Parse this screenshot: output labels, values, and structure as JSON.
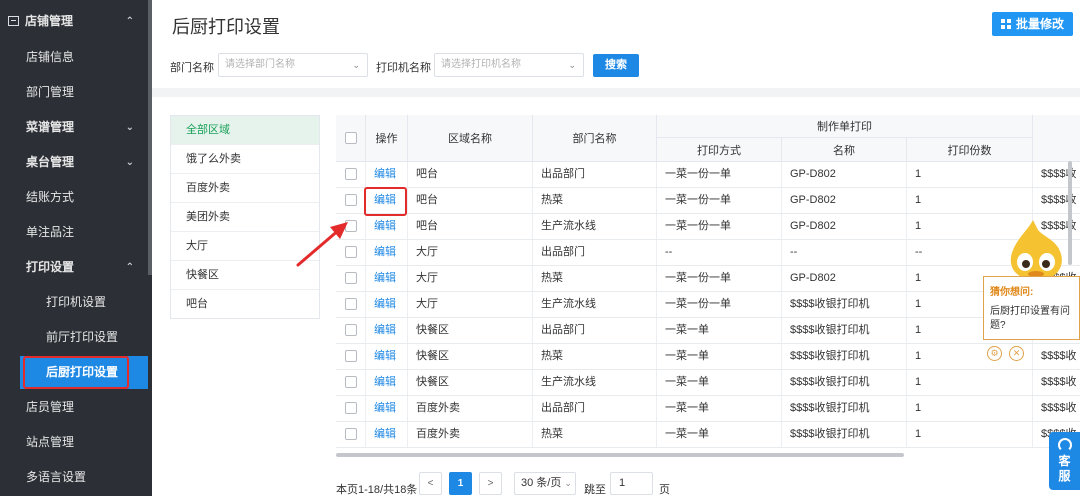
{
  "sidebar": {
    "items": [
      {
        "label": "店铺管理"
      },
      {
        "label": "店铺信息"
      },
      {
        "label": "部门管理"
      },
      {
        "label": "菜谱管理"
      },
      {
        "label": "桌台管理"
      },
      {
        "label": "结账方式"
      },
      {
        "label": "单注品注"
      },
      {
        "label": "打印设置"
      },
      {
        "label": "打印机设置"
      },
      {
        "label": "前厅打印设置"
      },
      {
        "label": "后厨打印设置"
      },
      {
        "label": "店员管理"
      },
      {
        "label": "站点管理"
      },
      {
        "label": "多语言设置"
      }
    ]
  },
  "header": {
    "title": "后厨打印设置",
    "batch_label": "批量修改"
  },
  "filters": {
    "dept_label": "部门名称",
    "dept_placeholder": "请选择部门名称",
    "printer_label": "打印机名称",
    "printer_placeholder": "请选择打印机名称",
    "search_label": "搜索"
  },
  "regions": [
    "全部区域",
    "饿了么外卖",
    "百度外卖",
    "美团外卖",
    "大厅",
    "快餐区",
    "吧台"
  ],
  "table": {
    "headers": {
      "op": "操作",
      "area": "区域名称",
      "dept": "部门名称",
      "group": "制作单打印",
      "method": "打印方式",
      "name": "名称",
      "copies": "打印份数"
    },
    "edit_label": "编辑",
    "rows": [
      {
        "area": "吧台",
        "dept": "出品部门",
        "method": "一菜一份一单",
        "name": "GP-D802",
        "copies": "1",
        "extra": "$$$$收"
      },
      {
        "area": "吧台",
        "dept": "热菜",
        "method": "一菜一份一单",
        "name": "GP-D802",
        "copies": "1",
        "extra": "$$$$收"
      },
      {
        "area": "吧台",
        "dept": "生产流水线",
        "method": "一菜一份一单",
        "name": "GP-D802",
        "copies": "1",
        "extra": "$$$$收"
      },
      {
        "area": "大厅",
        "dept": "出品部门",
        "method": "--",
        "name": "--",
        "copies": "--",
        "extra": "--"
      },
      {
        "area": "大厅",
        "dept": "热菜",
        "method": "一菜一份一单",
        "name": "GP-D802",
        "copies": "1",
        "extra": "$$$$收"
      },
      {
        "area": "大厅",
        "dept": "生产流水线",
        "method": "一菜一份一单",
        "name": "$$$$收银打印机",
        "copies": "1",
        "extra": "$$$$收"
      },
      {
        "area": "快餐区",
        "dept": "出品部门",
        "method": "一菜一单",
        "name": "$$$$收银打印机",
        "copies": "1",
        "extra": "$$$$收"
      },
      {
        "area": "快餐区",
        "dept": "热菜",
        "method": "一菜一单",
        "name": "$$$$收银打印机",
        "copies": "1",
        "extra": "$$$$收"
      },
      {
        "area": "快餐区",
        "dept": "生产流水线",
        "method": "一菜一单",
        "name": "$$$$收银打印机",
        "copies": "1",
        "extra": "$$$$收"
      },
      {
        "area": "百度外卖",
        "dept": "出品部门",
        "method": "一菜一单",
        "name": "$$$$收银打印机",
        "copies": "1",
        "extra": "$$$$收"
      },
      {
        "area": "百度外卖",
        "dept": "热菜",
        "method": "一菜一单",
        "name": "$$$$收银打印机",
        "copies": "1",
        "extra": "$$$$收"
      }
    ]
  },
  "pagination": {
    "summary": "本页1-18/共18条",
    "prev": "<",
    "current": "1",
    "next": ">",
    "page_size": "30 条/页",
    "jump_label": "跳至",
    "jump_value": "1",
    "page_unit": "页"
  },
  "assistant": {
    "title": "猜你想问:",
    "question": "后厨打印设置有问题?"
  },
  "customer_service": {
    "line1": "客",
    "line2": "服"
  },
  "colors": {
    "sidebar_bg": "#2c3036",
    "primary": "#1e88e5",
    "highlight": "#e32b2b",
    "active_region": "#18a058"
  }
}
